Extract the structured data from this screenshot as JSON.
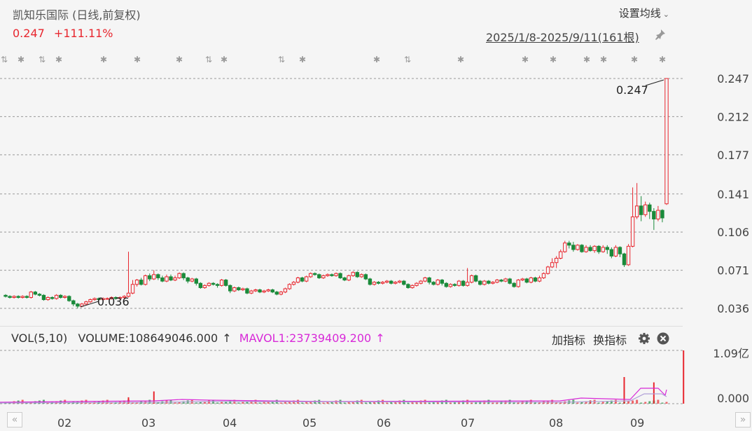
{
  "header": {
    "title": "凯知乐国际 (日线,前复权)",
    "price": "0.247",
    "change": "+111.11%",
    "ma_setting": "设置均线",
    "date_range": "2025/1/8-2025/9/11(161根)"
  },
  "colors": {
    "up": "#e8262e",
    "down": "#1a8a3a",
    "mavol": "#d82ad8",
    "grid": "#999999"
  },
  "chart_data": [
    {
      "type": "candlestick",
      "title": "凯知乐国际 (日线,前复权)",
      "y_ticks": [
        "0.247",
        "0.212",
        "0.177",
        "0.141",
        "0.106",
        "0.071",
        "0.036"
      ],
      "ylim": [
        0.036,
        0.247
      ],
      "annotations": [
        {
          "text": "0.247",
          "label": "high"
        },
        {
          "text": "0.036",
          "label": "low"
        }
      ],
      "x_ticks": [
        "02",
        "03",
        "04",
        "05",
        "06",
        "07",
        "08",
        "09"
      ],
      "candles": [
        [
          0.048,
          0.047,
          0.049,
          0.046
        ],
        [
          0.047,
          0.046,
          0.048,
          0.045
        ],
        [
          0.046,
          0.047,
          0.048,
          0.045
        ],
        [
          0.047,
          0.046,
          0.048,
          0.045
        ],
        [
          0.046,
          0.047,
          0.048,
          0.045
        ],
        [
          0.047,
          0.046,
          0.048,
          0.045
        ],
        [
          0.046,
          0.051,
          0.052,
          0.045
        ],
        [
          0.051,
          0.049,
          0.052,
          0.048
        ],
        [
          0.049,
          0.048,
          0.05,
          0.047
        ],
        [
          0.048,
          0.044,
          0.049,
          0.043
        ],
        [
          0.044,
          0.046,
          0.047,
          0.043
        ],
        [
          0.046,
          0.045,
          0.047,
          0.044
        ],
        [
          0.045,
          0.048,
          0.049,
          0.044
        ],
        [
          0.048,
          0.046,
          0.049,
          0.045
        ],
        [
          0.046,
          0.047,
          0.048,
          0.045
        ],
        [
          0.047,
          0.043,
          0.048,
          0.042
        ],
        [
          0.043,
          0.04,
          0.044,
          0.038
        ],
        [
          0.04,
          0.038,
          0.041,
          0.036
        ],
        [
          0.038,
          0.04,
          0.041,
          0.037
        ],
        [
          0.04,
          0.042,
          0.043,
          0.039
        ],
        [
          0.042,
          0.044,
          0.045,
          0.041
        ],
        [
          0.044,
          0.045,
          0.046,
          0.043
        ],
        [
          0.045,
          0.044,
          0.046,
          0.043
        ],
        [
          0.044,
          0.045,
          0.046,
          0.043
        ],
        [
          0.045,
          0.045,
          0.046,
          0.044
        ],
        [
          0.045,
          0.046,
          0.047,
          0.044
        ],
        [
          0.046,
          0.045,
          0.047,
          0.044
        ],
        [
          0.045,
          0.046,
          0.047,
          0.044
        ],
        [
          0.046,
          0.047,
          0.048,
          0.045
        ],
        [
          0.047,
          0.05,
          0.088,
          0.046
        ],
        [
          0.05,
          0.058,
          0.062,
          0.049
        ],
        [
          0.058,
          0.062,
          0.063,
          0.056
        ],
        [
          0.062,
          0.058,
          0.064,
          0.057
        ],
        [
          0.058,
          0.066,
          0.067,
          0.057
        ],
        [
          0.066,
          0.063,
          0.068,
          0.061
        ],
        [
          0.063,
          0.067,
          0.071,
          0.062
        ],
        [
          0.067,
          0.064,
          0.068,
          0.062
        ],
        [
          0.064,
          0.061,
          0.066,
          0.06
        ],
        [
          0.061,
          0.065,
          0.067,
          0.06
        ],
        [
          0.065,
          0.062,
          0.067,
          0.061
        ],
        [
          0.062,
          0.064,
          0.066,
          0.061
        ],
        [
          0.064,
          0.068,
          0.069,
          0.063
        ],
        [
          0.068,
          0.064,
          0.069,
          0.062
        ],
        [
          0.064,
          0.061,
          0.065,
          0.059
        ],
        [
          0.061,
          0.063,
          0.064,
          0.06
        ],
        [
          0.063,
          0.059,
          0.064,
          0.057
        ],
        [
          0.059,
          0.055,
          0.06,
          0.054
        ],
        [
          0.055,
          0.057,
          0.058,
          0.054
        ],
        [
          0.057,
          0.059,
          0.06,
          0.056
        ],
        [
          0.059,
          0.058,
          0.06,
          0.057
        ],
        [
          0.058,
          0.057,
          0.059,
          0.055
        ],
        [
          0.057,
          0.062,
          0.063,
          0.056
        ],
        [
          0.062,
          0.057,
          0.063,
          0.056
        ],
        [
          0.057,
          0.052,
          0.058,
          0.05
        ],
        [
          0.052,
          0.055,
          0.056,
          0.051
        ],
        [
          0.055,
          0.053,
          0.056,
          0.052
        ],
        [
          0.053,
          0.054,
          0.055,
          0.052
        ],
        [
          0.054,
          0.05,
          0.055,
          0.049
        ],
        [
          0.05,
          0.052,
          0.053,
          0.049
        ],
        [
          0.052,
          0.053,
          0.054,
          0.051
        ],
        [
          0.053,
          0.051,
          0.054,
          0.05
        ],
        [
          0.051,
          0.052,
          0.053,
          0.05
        ],
        [
          0.052,
          0.053,
          0.054,
          0.051
        ],
        [
          0.053,
          0.051,
          0.054,
          0.05
        ],
        [
          0.051,
          0.049,
          0.052,
          0.048
        ],
        [
          0.049,
          0.051,
          0.052,
          0.048
        ],
        [
          0.051,
          0.054,
          0.055,
          0.05
        ],
        [
          0.054,
          0.058,
          0.059,
          0.053
        ],
        [
          0.058,
          0.06,
          0.061,
          0.057
        ],
        [
          0.06,
          0.064,
          0.065,
          0.059
        ],
        [
          0.064,
          0.061,
          0.065,
          0.06
        ],
        [
          0.061,
          0.065,
          0.066,
          0.06
        ],
        [
          0.065,
          0.068,
          0.069,
          0.064
        ],
        [
          0.068,
          0.067,
          0.069,
          0.066
        ],
        [
          0.067,
          0.064,
          0.068,
          0.063
        ],
        [
          0.064,
          0.066,
          0.067,
          0.063
        ],
        [
          0.066,
          0.067,
          0.068,
          0.065
        ],
        [
          0.067,
          0.066,
          0.068,
          0.065
        ],
        [
          0.066,
          0.068,
          0.069,
          0.065
        ],
        [
          0.068,
          0.064,
          0.069,
          0.063
        ],
        [
          0.064,
          0.062,
          0.065,
          0.061
        ],
        [
          0.062,
          0.066,
          0.067,
          0.061
        ],
        [
          0.066,
          0.069,
          0.07,
          0.065
        ],
        [
          0.069,
          0.065,
          0.07,
          0.064
        ],
        [
          0.065,
          0.067,
          0.068,
          0.064
        ],
        [
          0.067,
          0.063,
          0.068,
          0.062
        ],
        [
          0.063,
          0.058,
          0.064,
          0.057
        ],
        [
          0.058,
          0.06,
          0.061,
          0.057
        ],
        [
          0.06,
          0.059,
          0.061,
          0.058
        ],
        [
          0.059,
          0.06,
          0.061,
          0.058
        ],
        [
          0.06,
          0.061,
          0.062,
          0.059
        ],
        [
          0.061,
          0.059,
          0.062,
          0.058
        ],
        [
          0.059,
          0.06,
          0.061,
          0.058
        ],
        [
          0.06,
          0.061,
          0.062,
          0.059
        ],
        [
          0.061,
          0.058,
          0.062,
          0.057
        ],
        [
          0.058,
          0.055,
          0.059,
          0.054
        ],
        [
          0.055,
          0.057,
          0.058,
          0.054
        ],
        [
          0.057,
          0.059,
          0.06,
          0.056
        ],
        [
          0.059,
          0.061,
          0.062,
          0.058
        ],
        [
          0.061,
          0.064,
          0.065,
          0.06
        ],
        [
          0.064,
          0.06,
          0.065,
          0.058
        ],
        [
          0.06,
          0.058,
          0.061,
          0.057
        ],
        [
          0.058,
          0.062,
          0.063,
          0.057
        ],
        [
          0.062,
          0.059,
          0.063,
          0.057
        ],
        [
          0.059,
          0.056,
          0.06,
          0.055
        ],
        [
          0.056,
          0.058,
          0.059,
          0.055
        ],
        [
          0.058,
          0.057,
          0.059,
          0.056
        ],
        [
          0.057,
          0.061,
          0.062,
          0.056
        ],
        [
          0.061,
          0.057,
          0.062,
          0.056
        ],
        [
          0.057,
          0.06,
          0.073,
          0.056
        ],
        [
          0.06,
          0.066,
          0.067,
          0.059
        ],
        [
          0.066,
          0.061,
          0.067,
          0.06
        ],
        [
          0.061,
          0.058,
          0.062,
          0.057
        ],
        [
          0.058,
          0.061,
          0.062,
          0.057
        ],
        [
          0.061,
          0.059,
          0.062,
          0.058
        ],
        [
          0.059,
          0.06,
          0.061,
          0.058
        ],
        [
          0.06,
          0.062,
          0.063,
          0.059
        ],
        [
          0.062,
          0.061,
          0.063,
          0.06
        ],
        [
          0.061,
          0.063,
          0.064,
          0.06
        ],
        [
          0.063,
          0.059,
          0.064,
          0.058
        ],
        [
          0.059,
          0.056,
          0.06,
          0.055
        ],
        [
          0.056,
          0.062,
          0.063,
          0.055
        ],
        [
          0.062,
          0.063,
          0.064,
          0.061
        ],
        [
          0.063,
          0.06,
          0.064,
          0.059
        ],
        [
          0.06,
          0.064,
          0.065,
          0.059
        ],
        [
          0.064,
          0.061,
          0.065,
          0.06
        ],
        [
          0.061,
          0.064,
          0.066,
          0.06
        ],
        [
          0.064,
          0.068,
          0.069,
          0.063
        ],
        [
          0.068,
          0.074,
          0.075,
          0.067
        ],
        [
          0.074,
          0.078,
          0.082,
          0.073
        ],
        [
          0.078,
          0.082,
          0.084,
          0.073
        ],
        [
          0.082,
          0.088,
          0.09,
          0.081
        ],
        [
          0.088,
          0.096,
          0.098,
          0.087
        ],
        [
          0.096,
          0.094,
          0.098,
          0.091
        ],
        [
          0.094,
          0.09,
          0.097,
          0.088
        ],
        [
          0.09,
          0.094,
          0.095,
          0.089
        ],
        [
          0.094,
          0.088,
          0.095,
          0.087
        ],
        [
          0.088,
          0.092,
          0.094,
          0.087
        ],
        [
          0.092,
          0.089,
          0.094,
          0.088
        ],
        [
          0.089,
          0.093,
          0.094,
          0.087
        ],
        [
          0.093,
          0.088,
          0.094,
          0.086
        ],
        [
          0.088,
          0.092,
          0.094,
          0.087
        ],
        [
          0.092,
          0.09,
          0.094,
          0.086
        ],
        [
          0.09,
          0.084,
          0.092,
          0.082
        ],
        [
          0.084,
          0.092,
          0.094,
          0.083
        ],
        [
          0.092,
          0.086,
          0.093,
          0.083
        ],
        [
          0.086,
          0.076,
          0.087,
          0.074
        ],
        [
          0.076,
          0.093,
          0.095,
          0.075
        ],
        [
          0.093,
          0.12,
          0.147,
          0.092
        ],
        [
          0.12,
          0.13,
          0.151,
          0.118
        ],
        [
          0.13,
          0.122,
          0.139,
          0.116
        ],
        [
          0.122,
          0.131,
          0.134,
          0.12
        ],
        [
          0.131,
          0.125,
          0.133,
          0.118
        ],
        [
          0.125,
          0.118,
          0.128,
          0.108
        ],
        [
          0.118,
          0.126,
          0.13,
          0.116
        ],
        [
          0.126,
          0.119,
          0.127,
          0.115
        ],
        [
          0.132,
          0.247,
          0.247,
          0.131
        ]
      ]
    },
    {
      "type": "bar",
      "title": "VOL(5,10)",
      "y_ticks": [
        "1.09亿",
        "0.000"
      ],
      "ylim": [
        0,
        108649046
      ],
      "series": [
        {
          "name": "VOLUME",
          "latest": "108649046.000"
        },
        {
          "name": "MAVOL1",
          "latest": "23739409.200"
        }
      ],
      "spike_indices": [
        29,
        35,
        138,
        146,
        153,
        160
      ],
      "spike_heights": [
        0.12,
        0.23,
        0.06,
        0.5,
        0.4,
        1.0
      ]
    }
  ],
  "events": [
    {
      "icon": "split-icon",
      "glyph": "⇅"
    },
    {
      "icon": "star-icon",
      "glyph": "✱"
    },
    {
      "icon": "split-icon",
      "glyph": "⇅"
    },
    {
      "icon": "star-icon",
      "glyph": "✱"
    },
    {
      "icon": "star-icon",
      "glyph": "✱"
    },
    {
      "icon": "star-icon",
      "glyph": "✱"
    },
    {
      "icon": "star-icon",
      "glyph": "✱"
    },
    {
      "icon": "split-icon",
      "glyph": "⇅"
    },
    {
      "icon": "star-icon",
      "glyph": "✱"
    },
    {
      "icon": "split-icon",
      "glyph": "⇅"
    },
    {
      "icon": "star-icon",
      "glyph": "✱"
    },
    {
      "icon": "star-icon",
      "glyph": "✱"
    },
    {
      "icon": "split-icon",
      "glyph": "⇅"
    },
    {
      "icon": "star-icon",
      "glyph": "✱"
    },
    {
      "icon": "star-icon",
      "glyph": "✱"
    },
    {
      "icon": "star-icon",
      "glyph": "✱"
    },
    {
      "icon": "star-icon",
      "glyph": "✱"
    },
    {
      "icon": "star-icon",
      "glyph": "✱"
    },
    {
      "icon": "star-icon",
      "glyph": "✱"
    },
    {
      "icon": "star-icon",
      "glyph": "✱"
    }
  ],
  "indicator": {
    "vol_label": "VOL(5,10)",
    "volume_label": "VOLUME:108649046.000",
    "volume_arrow": "↑",
    "mavol_label": "MAVOL1:23739409.200",
    "mavol_arrow": "↑",
    "add_indicator": "加指标",
    "switch_indicator": "换指标"
  },
  "scroll": {
    "left": "«",
    "right": "»"
  }
}
